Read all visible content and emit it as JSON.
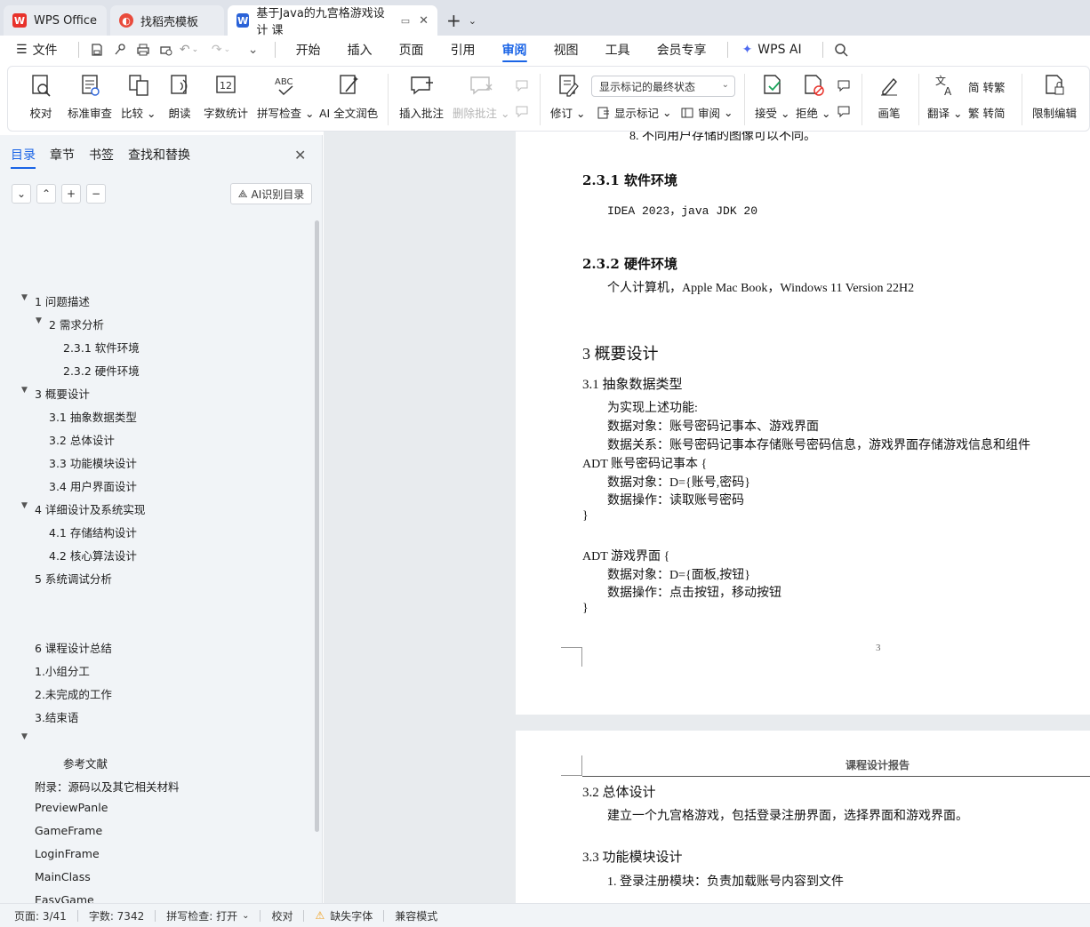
{
  "tabs": [
    {
      "label": "WPS Office",
      "icon": "wps-logo-icon"
    },
    {
      "label": "找稻壳模板",
      "icon": "docer-icon"
    },
    {
      "label": "基于Java的九宫格游戏设计 课",
      "icon": "word-doc-icon"
    }
  ],
  "menu": {
    "file": "文件",
    "items": [
      "开始",
      "插入",
      "页面",
      "引用",
      "审阅",
      "视图",
      "工具",
      "会员专享"
    ],
    "active": "审阅",
    "wps_ai": "WPS AI"
  },
  "ribbon": {
    "proofread": "校对",
    "standard_review": "标准审查",
    "compare": "比较",
    "read_aloud": "朗读",
    "word_count": "字数统计",
    "spell_check": "拼写检查",
    "ai_polish": "AI 全文润色",
    "insert_comment": "插入批注",
    "delete_comment": "删除批注",
    "revise": "修订",
    "markup_select": "显示标记的最终状态",
    "show_markup": "显示标记",
    "review": "审阅",
    "accept": "接受",
    "reject": "拒绝",
    "brush": "画笔",
    "translate": "翻译",
    "to_traditional": "转繁",
    "to_simplified": "转简",
    "restrict_edit": "限制编辑"
  },
  "nav": {
    "tabs": [
      "目录",
      "章节",
      "书签",
      "查找和替换"
    ],
    "ai_toc": "AI识别目录",
    "toc": [
      {
        "text": "1  问题描述",
        "arrow": true
      },
      {
        "text": "2  需求分析",
        "arrow": true
      },
      {
        "text": "2.3.1 软件环境",
        "arrow": false
      },
      {
        "text": "2.3.2 硬件环境",
        "arrow": false
      },
      {
        "text": "3  概要设计",
        "arrow": true
      },
      {
        "text": "3.1 抽象数据类型",
        "arrow": false
      },
      {
        "text": "3.2  总体设计",
        "arrow": false
      },
      {
        "text": "3.3  功能模块设计",
        "arrow": false
      },
      {
        "text": "3.4  用户界面设计",
        "arrow": false
      },
      {
        "text": "4  详细设计及系统实现",
        "arrow": true
      },
      {
        "text": "4.1  存储结构设计",
        "arrow": false
      },
      {
        "text": "4.2  核心算法设计",
        "arrow": false
      },
      {
        "text": "5  系统调试分析",
        "arrow": false
      },
      {
        "text": "6  课程设计总结",
        "arrow": false
      },
      {
        "text": "1.小组分工",
        "arrow": false
      },
      {
        "text": "2.未完成的工作",
        "arrow": false
      },
      {
        "text": "3.结束语",
        "arrow": false
      },
      {
        "text": "",
        "arrow": true
      },
      {
        "text": "参考文献",
        "arrow": false
      },
      {
        "text": "附录：源码以及其它相关材料",
        "arrow": false
      },
      {
        "text": "PreviewPanle",
        "arrow": false
      },
      {
        "text": "GameFrame",
        "arrow": false
      },
      {
        "text": "LoginFrame",
        "arrow": false
      },
      {
        "text": "MainClass",
        "arrow": false
      },
      {
        "text": "EasyGame",
        "arrow": false
      }
    ]
  },
  "doc": {
    "partial_top": "8. 不同用户存储的图像可以不同。",
    "h_231": "2.3.1 软件环境",
    "sw_env": "IDEA 2023，java JDK 20",
    "h_232": "2.3.2 硬件环境",
    "hw_env": "个人计算机，Apple Mac Book，Windows 11 Version 22H2",
    "h_3": "3  概要设计",
    "h_31": "3.1 抽象数据类型",
    "p1": "为实现上述功能:",
    "p2": "数据对象：账号密码记事本、游戏界面",
    "p3": "数据关系：账号密码记事本存储账号密码信息，游戏界面存储游戏信息和组件",
    "adt1": "ADT 账号密码记事本 {",
    "adt1_obj": "数据对象：D={账号,密码}",
    "adt1_op": "数据操作：读取账号密码",
    "close1": "}",
    "adt2": "ADT 游戏界面 {",
    "adt2_obj": "数据对象：D={面板,按钮}",
    "adt2_op": "数据操作：点击按钮，移动按钮",
    "close2": "}",
    "page_num": "3",
    "header": "课程设计报告",
    "h_32": "3.2  总体设计",
    "p32": "建立一个九宫格游戏，包括登录注册界面，选择界面和游戏界面。",
    "h_33": "3.3  功能模块设计",
    "p33": "1. 登录注册模块：负责加载账号内容到文件"
  },
  "status": {
    "page": "页面: 3/41",
    "words": "字数: 7342",
    "spell": "拼写检查: 打开",
    "proof": "校对",
    "missing_font": "缺失字体",
    "compat": "兼容模式"
  },
  "colors": {
    "accent": "#1a64e6",
    "wps_red": "#e8322b",
    "word_blue": "#2a62d8",
    "warning": "#f0a020"
  }
}
